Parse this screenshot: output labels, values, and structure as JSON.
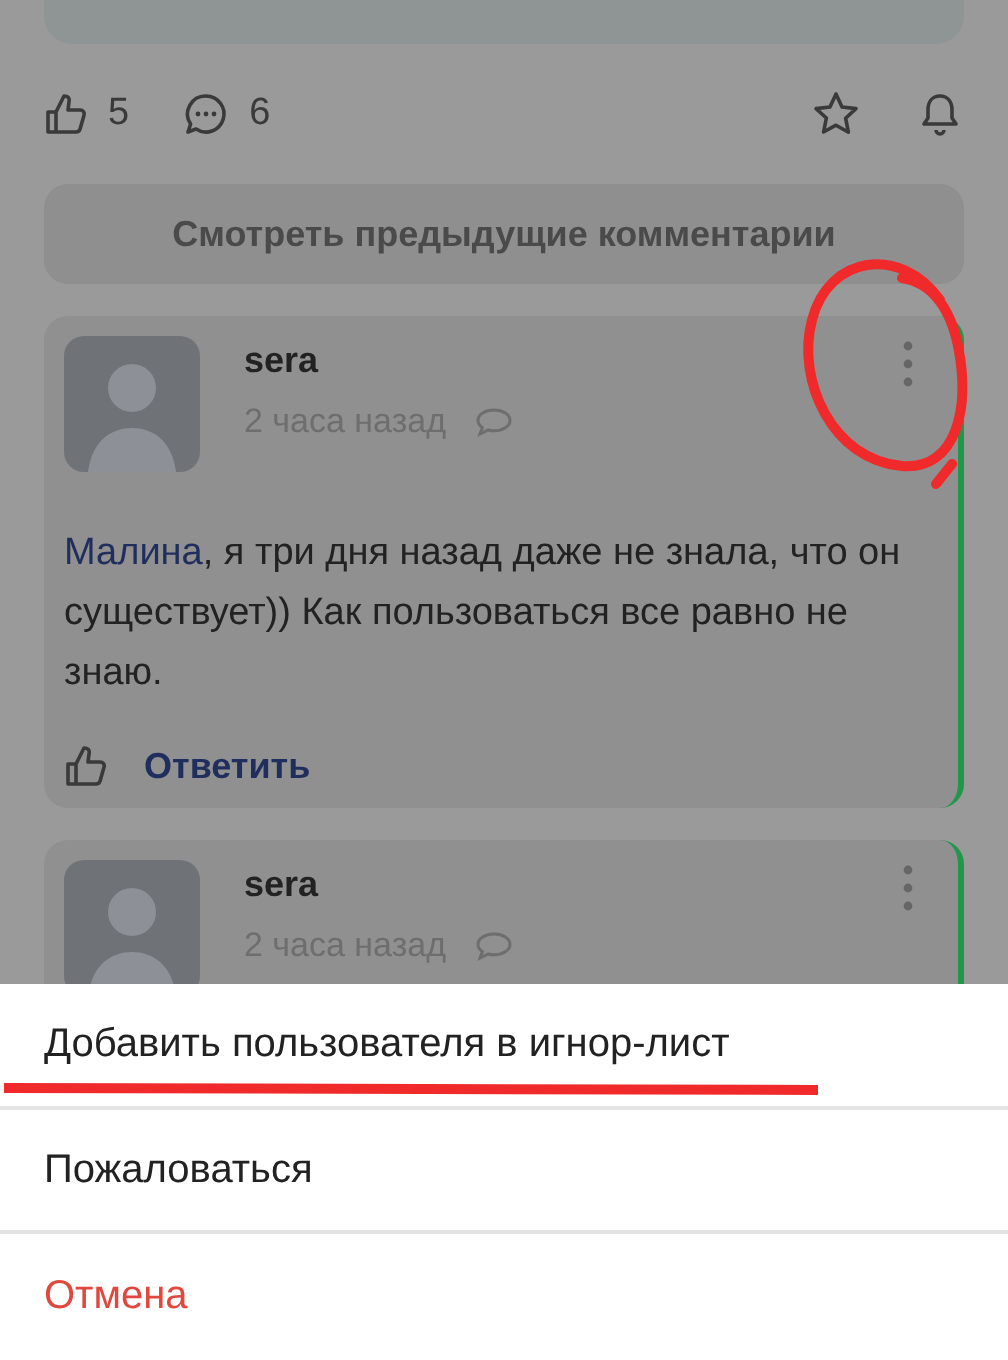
{
  "post_footer": {
    "likes": "5",
    "comments": "6"
  },
  "previous_button": "Смотреть предыдущие комментарии",
  "comments": [
    {
      "author": "sera",
      "time": "2 часа назад",
      "mention": "Малина",
      "text": ", я три дня назад даже не знала, что он существует)) Как пользоваться все равно не знаю.",
      "reply": "Ответить"
    },
    {
      "author": "sera",
      "time": "2 часа назад"
    }
  ],
  "sheet": {
    "items": [
      {
        "label": "Добавить пользователя в игнор-лист",
        "kind": "normal"
      },
      {
        "label": "Пожаловаться",
        "kind": "normal"
      },
      {
        "label": "Отмена",
        "kind": "cancel"
      }
    ]
  }
}
